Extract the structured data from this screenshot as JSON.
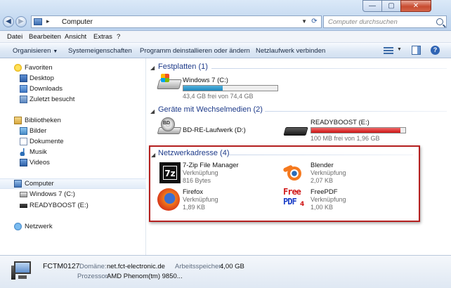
{
  "window": {
    "address_path": "Computer",
    "search_placeholder": "Computer durchsuchen",
    "controls": {
      "minimize": "—",
      "maximize": "▢",
      "close": "✕"
    }
  },
  "menu": [
    "Datei",
    "Bearbeiten",
    "Ansicht",
    "Extras",
    "?"
  ],
  "commands": {
    "organize": "Organisieren",
    "system_properties": "Systemeigenschaften",
    "uninstall": "Programm deinstallieren oder ändern",
    "map_drive": "Netzlaufwerk verbinden"
  },
  "nav": {
    "favorites": "Favoriten",
    "desktop": "Desktop",
    "downloads": "Downloads",
    "recent": "Zuletzt besucht",
    "libraries": "Bibliotheken",
    "pictures": "Bilder",
    "documents": "Dokumente",
    "music": "Musik",
    "videos": "Videos",
    "computer": "Computer",
    "drive_c": "Windows 7 (C:)",
    "drive_e": "READYBOOST (E:)",
    "network": "Netzwerk"
  },
  "groups": {
    "hdd": {
      "title": "Festplatten (1)",
      "items": [
        {
          "name": "Windows 7 (C:)",
          "space": "43,4 GB frei von 74,4 GB",
          "used_fraction": 0.42
        }
      ]
    },
    "removable": {
      "title": "Geräte mit Wechselmedien (2)",
      "items": [
        {
          "name": "BD-RE-Laufwerk (D:)"
        },
        {
          "name": "READYBOOST (E:)",
          "space": "100 MB frei von 1,96 GB",
          "used_fraction": 0.95
        }
      ]
    },
    "network": {
      "title": "Netzwerkadresse (4)",
      "items": [
        {
          "name": "7-Zip File Manager",
          "type": "Verknüpfung",
          "size": "816 Bytes"
        },
        {
          "name": "Blender",
          "type": "Verknüpfung",
          "size": "2,07 KB"
        },
        {
          "name": "Firefox",
          "type": "Verknüpfung",
          "size": "1,89 KB"
        },
        {
          "name": "FreePDF",
          "type": "Verknüpfung",
          "size": "1,00 KB"
        }
      ]
    }
  },
  "details": {
    "computer_name": "FCTM0127",
    "domain_label": "Domäne:",
    "domain_value": "net.fct-electronic.de",
    "memory_label": "Arbeitsspeicher:",
    "memory_value": "4,00 GB",
    "cpu_label": "Prozessor:",
    "cpu_value": "AMD Phenom(tm) 9850..."
  },
  "icons": {
    "7zip_mark": "7z",
    "freepdf_line1": "Free",
    "freepdf_line2": "PDF",
    "freepdf_sub": "4",
    "bd_mark": "BD",
    "help": "?"
  },
  "colors": {
    "group_title": "#1e3b8a",
    "highlight_border": "#b52020",
    "bar_blue": "#1f86bd",
    "bar_red": "#cc1414"
  }
}
